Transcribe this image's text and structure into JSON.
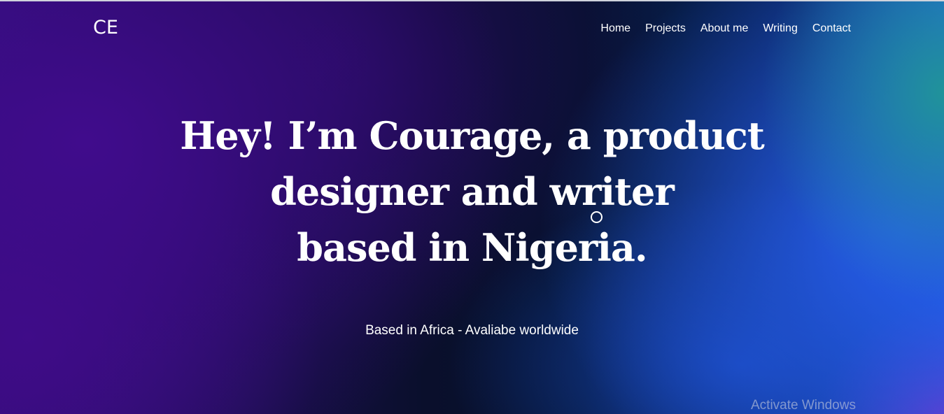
{
  "logo": "CE",
  "nav": {
    "items": [
      {
        "label": "Home"
      },
      {
        "label": "Projects"
      },
      {
        "label": "About me"
      },
      {
        "label": "Writing"
      },
      {
        "label": "Contact"
      }
    ]
  },
  "hero": {
    "headline_lines": [
      "Hey! I’m Courage, a product",
      "designer and writer",
      "based in Nigeria."
    ],
    "tagline": "Based in Africa - Avaliabe worldwide"
  },
  "watermark": "Activate Windows",
  "colors": {
    "text": "#ffffff",
    "purple": "#3b0c86",
    "blue": "#265ce8",
    "teal": "#2096a0"
  }
}
